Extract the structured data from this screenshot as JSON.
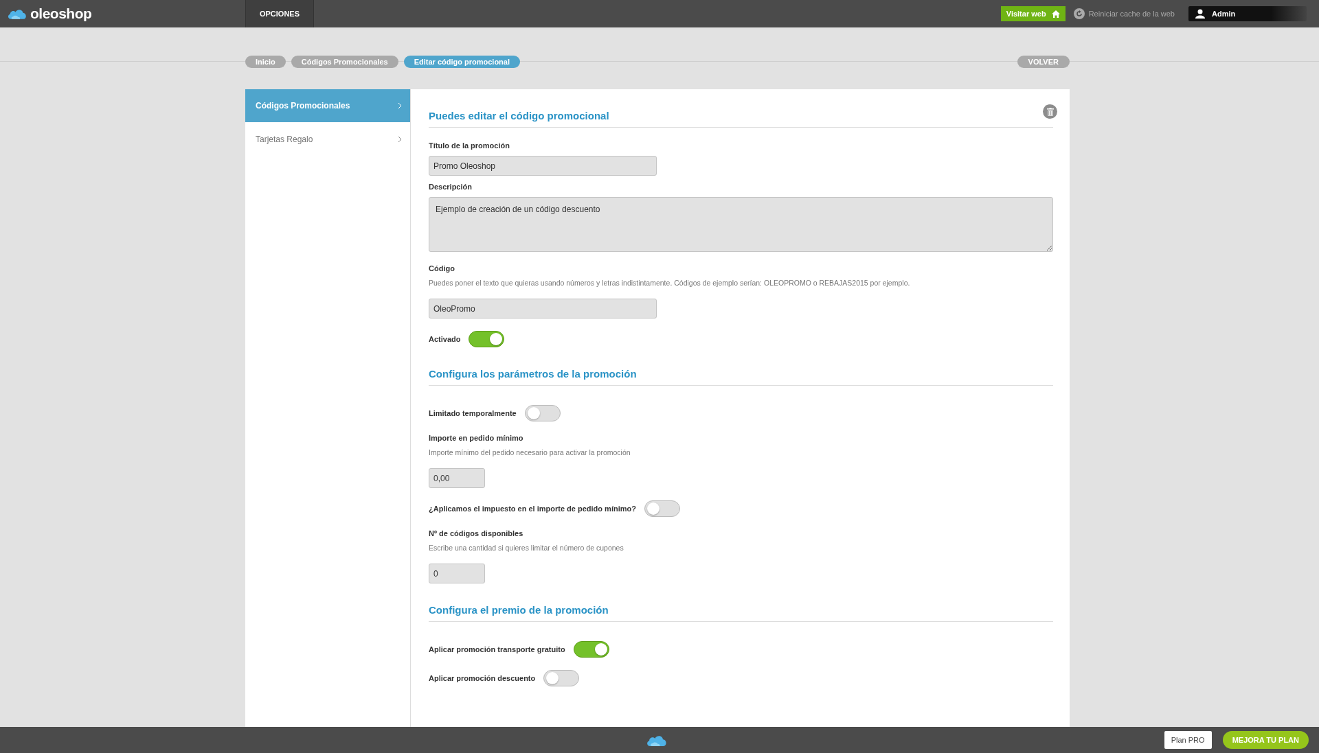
{
  "topbar": {
    "brand": "oleoshop",
    "menu": "OPCIONES",
    "visit_button": "Visitar web",
    "cache_link": "Reiniciar cache de la web",
    "user": "Admin"
  },
  "breadcrumbs": [
    {
      "label": "Inicio",
      "selected": false
    },
    {
      "label": "Códigos Promocionales",
      "selected": false
    },
    {
      "label": "Editar código promocional",
      "selected": true
    }
  ],
  "back_button": "VOLVER",
  "sidebar": {
    "items": [
      {
        "label": "Códigos Promocionales",
        "selected": true
      },
      {
        "label": "Tarjetas Regalo",
        "selected": false
      }
    ]
  },
  "sections": [
    {
      "title": "Puedes editar el código promocional",
      "fields": [
        {
          "kind": "text",
          "label": "Título de la promoción",
          "value": "Promo Oleoshop"
        },
        {
          "kind": "textarea",
          "label": "Descripción",
          "value": "Ejemplo de creación de un código descuento"
        },
        {
          "kind": "text",
          "label": "Código",
          "help": "Puedes poner el texto que quieras usando números y letras indistintamente. Códigos de ejemplo serían: OLEOPROMO o REBAJAS2015 por ejemplo.",
          "value": "OleoPromo"
        },
        {
          "kind": "toggle",
          "label": "Activado",
          "on": true
        }
      ]
    },
    {
      "title": "Configura los parámetros de la promoción",
      "fields": [
        {
          "kind": "toggle",
          "label": "Limitado temporalmente",
          "on": false
        },
        {
          "kind": "number",
          "label": "Importe en pedido mínimo",
          "help": "Importe mínimo del pedido necesario para activar la promoción",
          "value": "0,00"
        },
        {
          "kind": "toggle",
          "label": "¿Aplicamos el impuesto en el importe de pedido mínimo?",
          "on": false
        },
        {
          "kind": "number",
          "label": "Nº de códigos disponibles",
          "help": "Escribe una cantidad si quieres limitar el número de cupones",
          "value": "0"
        }
      ]
    },
    {
      "title": "Configura el premio de la promoción",
      "fields": [
        {
          "kind": "toggle",
          "label": "Aplicar promoción transporte gratuito",
          "on": true
        },
        {
          "kind": "toggle",
          "label": "Aplicar promoción descuento",
          "on": false
        }
      ]
    }
  ],
  "footer": {
    "plan": "Plan PRO",
    "upgrade": "MEJORA TU PLAN"
  }
}
